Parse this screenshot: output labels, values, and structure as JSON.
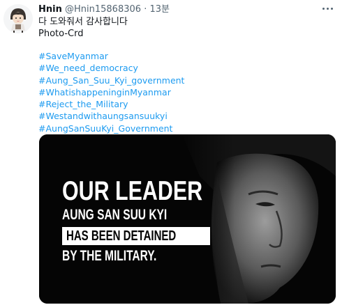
{
  "tweet": {
    "display_name": "Hnin",
    "handle": "@Hnin15868306",
    "separator": "·",
    "time": "13분",
    "body_lines": [
      "다 도와줘서 감사합니다",
      "Photo-Crd"
    ],
    "hashtags": [
      "#SaveMyanmar",
      "#We_need_democracy",
      "#Aung_San_Suu_Kyi_government",
      "#WhatishappeninginMyanmar",
      "#Reject_the_Military",
      "#Westandwithaungsansuukyi",
      "#AungSanSuuKyi_Government"
    ]
  },
  "poster": {
    "line1": "OUR LEADER",
    "line2": "AUNG SAN SUU KYI",
    "line3": "HAS BEEN DETAINED",
    "line4": "BY THE MILITARY."
  },
  "colors": {
    "link": "#1d9bf0",
    "secondary_text": "#536471",
    "media_background": "#050505"
  },
  "icons": {
    "more": "more-dots-icon",
    "avatar": "cartoon-avatar"
  }
}
